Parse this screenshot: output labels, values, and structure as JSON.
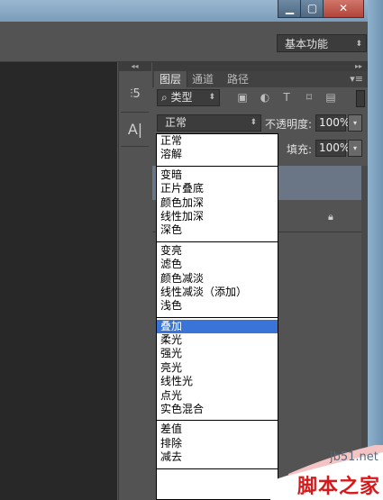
{
  "window": {
    "min_label": "▁",
    "max_label": "▢",
    "close_label": "✕"
  },
  "header": {
    "workspace": "基本功能"
  },
  "strip": {
    "collapse_label": "◂◂",
    "history_icon": "⫶5",
    "char_icon": "A|"
  },
  "panel": {
    "collapse_label": "▸▸",
    "tabs": [
      "图层",
      "通道",
      "路径"
    ],
    "menu_icon": "▾≡",
    "filter_label": "⌕ 类型",
    "filter_arrow": "⬍",
    "blend_mode": "正常",
    "opacity_label": "不透明度:",
    "opacity_value": "100%",
    "fill_label": "填充:",
    "fill_value": "100%",
    "arrow": "▾"
  },
  "dropdown": {
    "groups": [
      [
        "正常",
        "溶解"
      ],
      [
        "变暗",
        "正片叠底",
        "颜色加深",
        "线性加深",
        "深色"
      ],
      [
        "变亮",
        "滤色",
        "颜色减淡",
        "线性减淡（添加）",
        "浅色"
      ],
      [
        "叠加",
        "柔光",
        "强光",
        "亮光",
        "线性光",
        "点光",
        "实色混合"
      ],
      [
        "差值",
        "排除",
        "减去"
      ]
    ],
    "selected": "叠加"
  },
  "watermark": {
    "url": "jb51.net",
    "text": "脚本之家"
  },
  "colors": {
    "selection": "#3875d7",
    "panel_bg": "#535353",
    "canvas_bg": "#282828"
  }
}
